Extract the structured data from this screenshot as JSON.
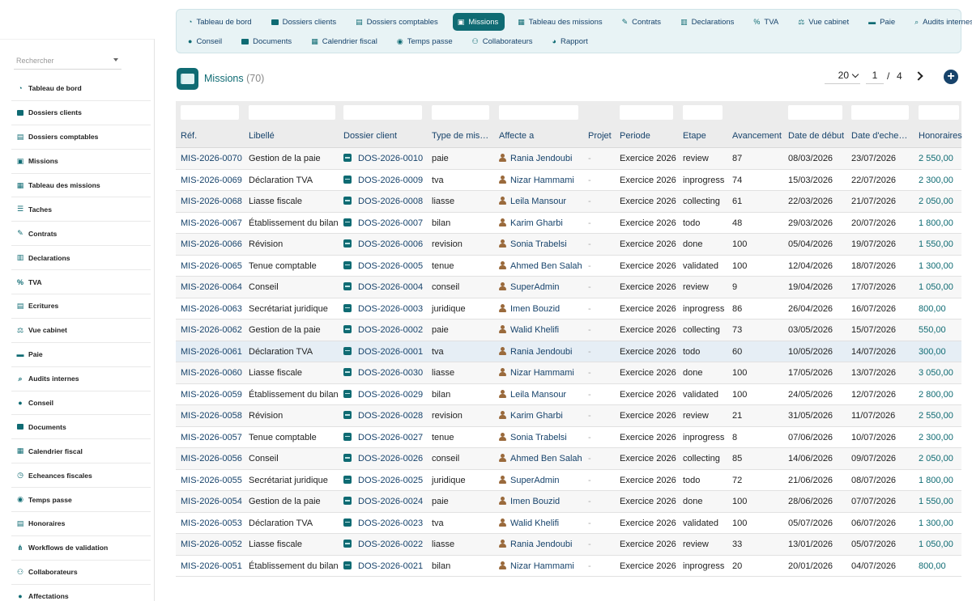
{
  "search": {
    "placeholder": "Rechercher"
  },
  "sidebar": {
    "items": [
      {
        "label": "Tableau de bord",
        "icon": "dashboard-icon"
      },
      {
        "label": "Dossiers clients",
        "icon": "folder-icon"
      },
      {
        "label": "Dossiers comptables",
        "icon": "book-icon"
      },
      {
        "label": "Missions",
        "icon": "briefcase-icon"
      },
      {
        "label": "Tableau des missions",
        "icon": "table-icon"
      },
      {
        "label": "Taches",
        "icon": "list-icon"
      },
      {
        "label": "Contrats",
        "icon": "contract-icon"
      },
      {
        "label": "Declarations",
        "icon": "document-icon"
      },
      {
        "label": "TVA",
        "icon": "percent-icon"
      },
      {
        "label": "Ecritures",
        "icon": "ledger-icon"
      },
      {
        "label": "Vue cabinet",
        "icon": "balance-icon"
      },
      {
        "label": "Paie",
        "icon": "money-icon"
      },
      {
        "label": "Audits internes",
        "icon": "search-icon"
      },
      {
        "label": "Conseil",
        "icon": "lightbulb-icon"
      },
      {
        "label": "Documents",
        "icon": "folder-icon"
      },
      {
        "label": "Calendrier fiscal",
        "icon": "calendar-icon"
      },
      {
        "label": "Echeances fiscales",
        "icon": "clock-icon"
      },
      {
        "label": "Temps passe",
        "icon": "stopwatch-icon"
      },
      {
        "label": "Honoraires",
        "icon": "invoice-icon"
      },
      {
        "label": "Workflows de validation",
        "icon": "workflow-icon"
      },
      {
        "label": "Collaborateurs",
        "icon": "users-icon"
      },
      {
        "label": "Affectations",
        "icon": "user-icon"
      }
    ]
  },
  "topnav": {
    "row1": [
      {
        "label": "Tableau de bord",
        "icon": "dashboard-icon",
        "active": false
      },
      {
        "label": "Dossiers clients",
        "icon": "folder-icon",
        "active": false
      },
      {
        "label": "Dossiers comptables",
        "icon": "book-icon",
        "active": false
      },
      {
        "label": "Missions",
        "icon": "briefcase-icon",
        "active": true
      },
      {
        "label": "Tableau des missions",
        "icon": "table-icon",
        "active": false
      },
      {
        "label": "Contrats",
        "icon": "contract-icon",
        "active": false
      },
      {
        "label": "Declarations",
        "icon": "document-icon",
        "active": false
      },
      {
        "label": "TVA",
        "icon": "percent-icon",
        "active": false
      },
      {
        "label": "Vue cabinet",
        "icon": "balance-icon",
        "active": false
      },
      {
        "label": "Paie",
        "icon": "money-icon",
        "active": false
      },
      {
        "label": "Audits internes",
        "icon": "search-icon",
        "active": false
      }
    ],
    "row2": [
      {
        "label": "Conseil",
        "icon": "lightbulb-icon",
        "active": false
      },
      {
        "label": "Documents",
        "icon": "folder-icon",
        "active": false
      },
      {
        "label": "Calendrier fiscal",
        "icon": "calendar-icon",
        "active": false
      },
      {
        "label": "Temps passe",
        "icon": "stopwatch-icon",
        "active": false
      },
      {
        "label": "Collaborateurs",
        "icon": "users-icon",
        "active": false
      },
      {
        "label": "Rapport",
        "icon": "chart-icon",
        "active": false
      }
    ]
  },
  "header": {
    "title": "Missions",
    "count": "(70)"
  },
  "pager": {
    "page_size": "20",
    "page": "1",
    "separator": "/",
    "total_pages": "4"
  },
  "table": {
    "columns": [
      "Réf.",
      "Libellé",
      "Dossier client",
      "Type de mis…",
      "Affecte a",
      "Projet",
      "Periode",
      "Etape",
      "Avancement",
      "Date de début",
      "Date d'eche…",
      "Honoraires"
    ],
    "rows": [
      [
        "MIS-2026-0070",
        "Gestion de la paie",
        "DOS-2026-0010",
        "paie",
        "Rania Jendoubi",
        "-",
        "Exercice 2026",
        "review",
        "87",
        "08/03/2026",
        "23/07/2026",
        "2 550,00"
      ],
      [
        "MIS-2026-0069",
        "Déclaration TVA",
        "DOS-2026-0009",
        "tva",
        "Nizar Hammami",
        "-",
        "Exercice 2026",
        "inprogress",
        "74",
        "15/03/2026",
        "22/07/2026",
        "2 300,00"
      ],
      [
        "MIS-2026-0068",
        "Liasse fiscale",
        "DOS-2026-0008",
        "liasse",
        "Leila Mansour",
        "-",
        "Exercice 2026",
        "collecting",
        "61",
        "22/03/2026",
        "21/07/2026",
        "2 050,00"
      ],
      [
        "MIS-2026-0067",
        "Établissement du bilan",
        "DOS-2026-0007",
        "bilan",
        "Karim Gharbi",
        "-",
        "Exercice 2026",
        "todo",
        "48",
        "29/03/2026",
        "20/07/2026",
        "1 800,00"
      ],
      [
        "MIS-2026-0066",
        "Révision",
        "DOS-2026-0006",
        "revision",
        "Sonia Trabelsi",
        "-",
        "Exercice 2026",
        "done",
        "100",
        "05/04/2026",
        "19/07/2026",
        "1 550,00"
      ],
      [
        "MIS-2026-0065",
        "Tenue comptable",
        "DOS-2026-0005",
        "tenue",
        "Ahmed Ben Salah",
        "-",
        "Exercice 2026",
        "validated",
        "100",
        "12/04/2026",
        "18/07/2026",
        "1 300,00"
      ],
      [
        "MIS-2026-0064",
        "Conseil",
        "DOS-2026-0004",
        "conseil",
        "SuperAdmin",
        "-",
        "Exercice 2026",
        "review",
        "9",
        "19/04/2026",
        "17/07/2026",
        "1 050,00"
      ],
      [
        "MIS-2026-0063",
        "Secrétariat juridique",
        "DOS-2026-0003",
        "juridique",
        "Imen Bouzid",
        "-",
        "Exercice 2026",
        "inprogress",
        "86",
        "26/04/2026",
        "16/07/2026",
        "800,00"
      ],
      [
        "MIS-2026-0062",
        "Gestion de la paie",
        "DOS-2026-0002",
        "paie",
        "Walid Khelifi",
        "-",
        "Exercice 2026",
        "collecting",
        "73",
        "03/05/2026",
        "15/07/2026",
        "550,00"
      ],
      [
        "MIS-2026-0061",
        "Déclaration TVA",
        "DOS-2026-0001",
        "tva",
        "Rania Jendoubi",
        "-",
        "Exercice 2026",
        "todo",
        "60",
        "10/05/2026",
        "14/07/2026",
        "300,00"
      ],
      [
        "MIS-2026-0060",
        "Liasse fiscale",
        "DOS-2026-0030",
        "liasse",
        "Nizar Hammami",
        "-",
        "Exercice 2026",
        "done",
        "100",
        "17/05/2026",
        "13/07/2026",
        "3 050,00"
      ],
      [
        "MIS-2026-0059",
        "Établissement du bilan",
        "DOS-2026-0029",
        "bilan",
        "Leila Mansour",
        "-",
        "Exercice 2026",
        "validated",
        "100",
        "24/05/2026",
        "12/07/2026",
        "2 800,00"
      ],
      [
        "MIS-2026-0058",
        "Révision",
        "DOS-2026-0028",
        "revision",
        "Karim Gharbi",
        "-",
        "Exercice 2026",
        "review",
        "21",
        "31/05/2026",
        "11/07/2026",
        "2 550,00"
      ],
      [
        "MIS-2026-0057",
        "Tenue comptable",
        "DOS-2026-0027",
        "tenue",
        "Sonia Trabelsi",
        "-",
        "Exercice 2026",
        "inprogress",
        "8",
        "07/06/2026",
        "10/07/2026",
        "2 300,00"
      ],
      [
        "MIS-2026-0056",
        "Conseil",
        "DOS-2026-0026",
        "conseil",
        "Ahmed Ben Salah",
        "-",
        "Exercice 2026",
        "collecting",
        "85",
        "14/06/2026",
        "09/07/2026",
        "2 050,00"
      ],
      [
        "MIS-2026-0055",
        "Secrétariat juridique",
        "DOS-2026-0025",
        "juridique",
        "SuperAdmin",
        "-",
        "Exercice 2026",
        "todo",
        "72",
        "21/06/2026",
        "08/07/2026",
        "1 800,00"
      ],
      [
        "MIS-2026-0054",
        "Gestion de la paie",
        "DOS-2026-0024",
        "paie",
        "Imen Bouzid",
        "-",
        "Exercice 2026",
        "done",
        "100",
        "28/06/2026",
        "07/07/2026",
        "1 550,00"
      ],
      [
        "MIS-2026-0053",
        "Déclaration TVA",
        "DOS-2026-0023",
        "tva",
        "Walid Khelifi",
        "-",
        "Exercice 2026",
        "validated",
        "100",
        "05/07/2026",
        "06/07/2026",
        "1 300,00"
      ],
      [
        "MIS-2026-0052",
        "Liasse fiscale",
        "DOS-2026-0022",
        "liasse",
        "Rania Jendoubi",
        "-",
        "Exercice 2026",
        "review",
        "33",
        "13/01/2026",
        "05/07/2026",
        "1 050,00"
      ],
      [
        "MIS-2026-0051",
        "Établissement du bilan",
        "DOS-2026-0021",
        "bilan",
        "Nizar Hammami",
        "-",
        "Exercice 2026",
        "inprogress",
        "20",
        "20/01/2026",
        "04/07/2026",
        "800,00"
      ]
    ],
    "highlighted_row": 9
  },
  "colors": {
    "accent": "#0f6b73",
    "link": "#17436b",
    "nav_bg": "#e8f3f5",
    "header_bg": "#ececec",
    "row_highlight": "#e6eef5"
  }
}
